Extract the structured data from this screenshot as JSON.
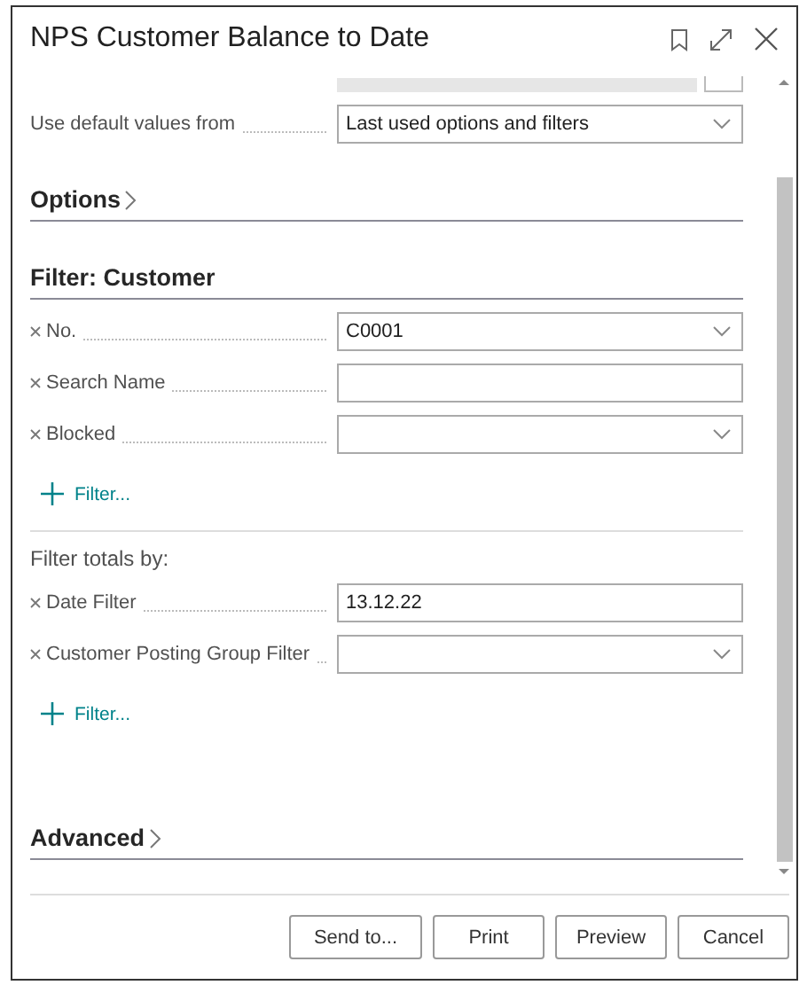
{
  "window": {
    "title": "NPS Customer Balance to Date"
  },
  "default_values": {
    "label": "Use default values from",
    "value": "Last used options and filters",
    "kind": "dropdown"
  },
  "options": {
    "title": "Options",
    "expanded": false
  },
  "filter_customer": {
    "title": "Filter: Customer",
    "fields": [
      {
        "label": "No.",
        "value": "C0001",
        "kind": "dropdown"
      },
      {
        "label": "Search Name",
        "kind": "text"
      },
      {
        "label": "Blocked",
        "kind": "dropdown"
      }
    ],
    "add_filter": "Filter..."
  },
  "filter_totals": {
    "title": "Filter totals by:",
    "fields": [
      {
        "label": "Date Filter",
        "value": "13.12.22",
        "kind": "text"
      },
      {
        "label": "Customer Posting Group Filter",
        "kind": "dropdown"
      }
    ],
    "add_filter": "Filter..."
  },
  "advanced": {
    "title": "Advanced",
    "expanded": false
  },
  "buttons": [
    "Send to...",
    "Print",
    "Preview",
    "Cancel"
  ]
}
